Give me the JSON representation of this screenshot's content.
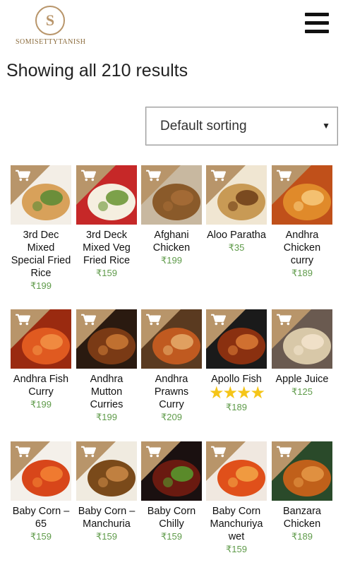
{
  "header": {
    "logo_mark": "S",
    "logo_text": "SomisettyTanish",
    "menu_icon": "hamburger-menu-icon"
  },
  "results_text": "Showing all 210 results",
  "sorting": {
    "selected": "Default sorting",
    "arrow": "▼"
  },
  "cart_icon": "cart-icon",
  "accent_color": "#b8956a",
  "price_color": "#5f9b4a",
  "products": [
    {
      "name": "3rd Dec Mixed Special Fried Rice",
      "price": "₹199"
    },
    {
      "name": "3rd Deck Mixed Veg Fried Rice",
      "price": "₹159"
    },
    {
      "name": "Afghani Chicken",
      "price": "₹199"
    },
    {
      "name": "Aloo Paratha",
      "price": "₹35"
    },
    {
      "name": "Andhra Chicken curry",
      "price": "₹189"
    },
    {
      "name": "Andhra Fish Curry",
      "price": "₹199"
    },
    {
      "name": "Andhra Mutton Curries",
      "price": "₹199"
    },
    {
      "name": "Andhra Prawns Curry",
      "price": "₹209"
    },
    {
      "name": "Apollo Fish",
      "price": "₹189",
      "rating": "★★★★"
    },
    {
      "name": "Apple Juice",
      "price": "₹125"
    },
    {
      "name": "Baby Corn – 65",
      "price": "₹159"
    },
    {
      "name": "Baby Corn – Manchuria",
      "price": "₹159"
    },
    {
      "name": "Baby Corn Chilly",
      "price": "₹159"
    },
    {
      "name": "Baby Corn Manchuriya wet",
      "price": "₹159"
    },
    {
      "name": "Banzara Chicken",
      "price": "₹189"
    }
  ]
}
